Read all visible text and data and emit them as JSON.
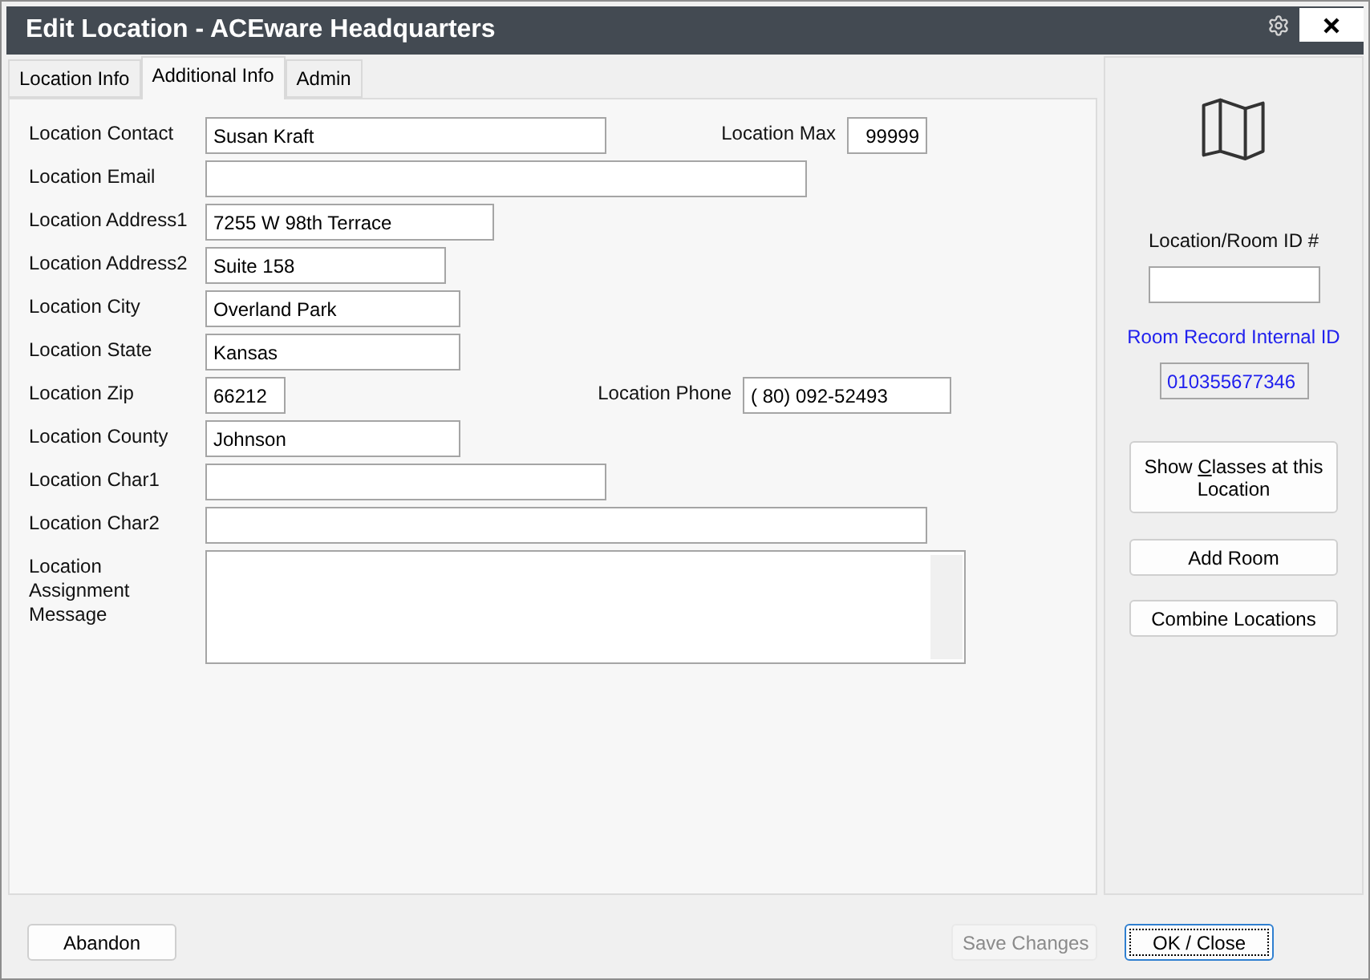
{
  "window": {
    "title": "Edit Location - ACEware Headquarters"
  },
  "tabs": [
    {
      "label": "Location Info",
      "selected": false
    },
    {
      "label": "Additional Info",
      "selected": true
    },
    {
      "label": "Admin",
      "selected": false
    }
  ],
  "fields": [
    {
      "label": "Location Contact",
      "kind": "text",
      "value": "Susan Kraft",
      "side_field": {
        "label": "Location Max",
        "kind": "number",
        "value": "99999"
      }
    },
    {
      "label": "Location Email",
      "kind": "text"
    },
    {
      "label": "Location Address1",
      "kind": "text",
      "value": "7255 W 98th Terrace"
    },
    {
      "label": "Location Address2",
      "kind": "text",
      "value": "Suite 158"
    },
    {
      "label": "Location City",
      "kind": "text",
      "value": "Overland Park"
    },
    {
      "label": "Location State",
      "kind": "text",
      "value": "Kansas"
    },
    {
      "label": "Location Zip",
      "kind": "text",
      "value": "66212",
      "side_field": {
        "label": "Location Phone",
        "kind": "phone",
        "value": "( 80) 092-52493"
      }
    },
    {
      "label": "Location County",
      "kind": "text",
      "value": "Johnson"
    },
    {
      "label": "Location Char1",
      "kind": "text"
    },
    {
      "label": "Location Char2",
      "kind": "text"
    },
    {
      "label": "Location Assignment Message",
      "kind": "memo"
    }
  ],
  "side_panel": {
    "id_label": "Location/Room ID #",
    "internal_id_label": "Room Record Internal ID",
    "internal_id": "010355677346",
    "buttons": [
      {
        "label_before": "Show ",
        "access_key": "C",
        "label_after": "lasses at this Location"
      },
      {
        "label": "Add Room"
      },
      {
        "label": "Combine Locations"
      }
    ]
  },
  "footer_buttons": [
    {
      "label": "Abandon",
      "disabled": false,
      "default": false
    },
    {
      "label": "Save Changes",
      "disabled": true,
      "default": false
    },
    {
      "label": "OK / Close",
      "disabled": false,
      "default": true
    }
  ]
}
